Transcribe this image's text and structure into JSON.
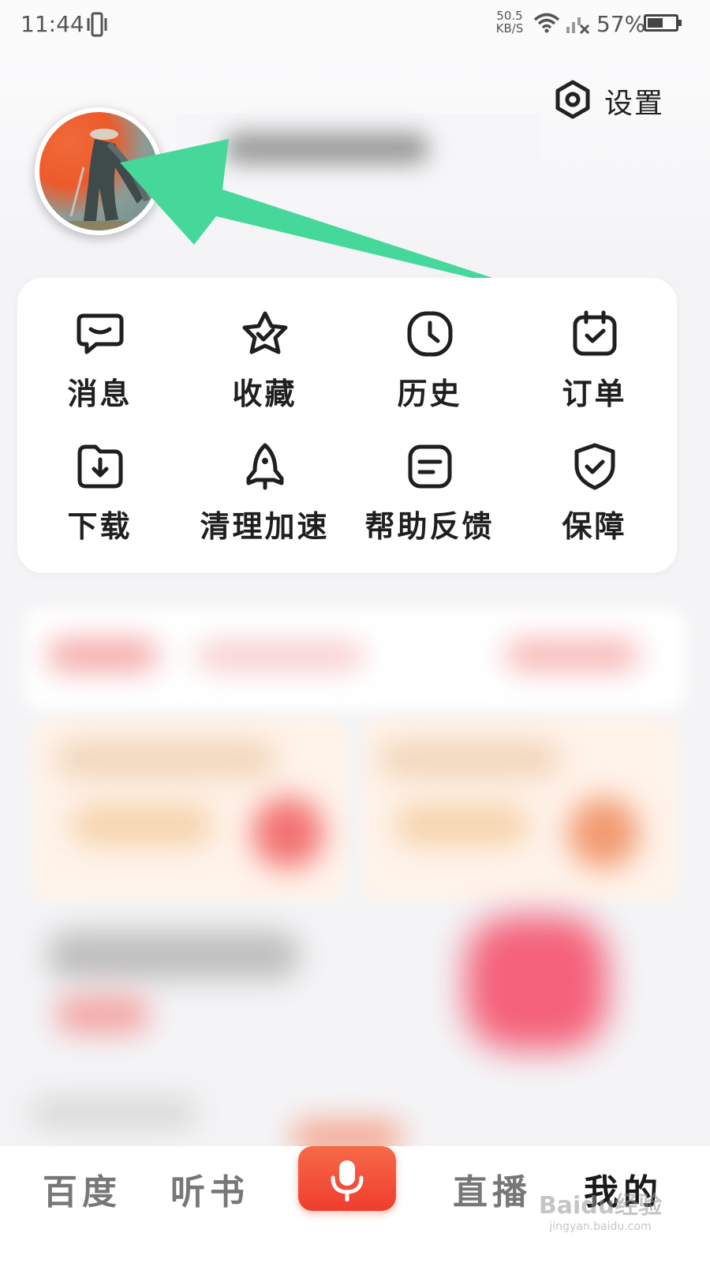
{
  "status_bar": {
    "time": "11:44",
    "speed_value": "50.5",
    "speed_unit": "KB/S",
    "battery_text": "57%",
    "battery_level": 0.57
  },
  "header": {
    "settings_label": "设置",
    "settings_icon": "hexagon-settings-icon"
  },
  "grid": {
    "items": [
      {
        "label": "消息",
        "icon": "message-icon"
      },
      {
        "label": "收藏",
        "icon": "star-icon"
      },
      {
        "label": "历史",
        "icon": "clock-icon"
      },
      {
        "label": "订单",
        "icon": "calendar-check-icon"
      },
      {
        "label": "下载",
        "icon": "download-icon"
      },
      {
        "label": "清理加速",
        "icon": "rocket-icon"
      },
      {
        "label": "帮助反馈",
        "icon": "feedback-icon"
      },
      {
        "label": "保障",
        "icon": "shield-check-icon"
      }
    ]
  },
  "bottom_nav": {
    "items": [
      {
        "label": "百度"
      },
      {
        "label": "听书"
      },
      {
        "label": "直播"
      },
      {
        "label": "我的"
      }
    ],
    "mic_icon": "microphone-icon"
  },
  "watermark": {
    "main": "Baidu经验",
    "url": "jingyan.baidu.com"
  },
  "colors": {
    "accent_red": "#ef3d2e",
    "arrow_green": "#46d89a"
  }
}
